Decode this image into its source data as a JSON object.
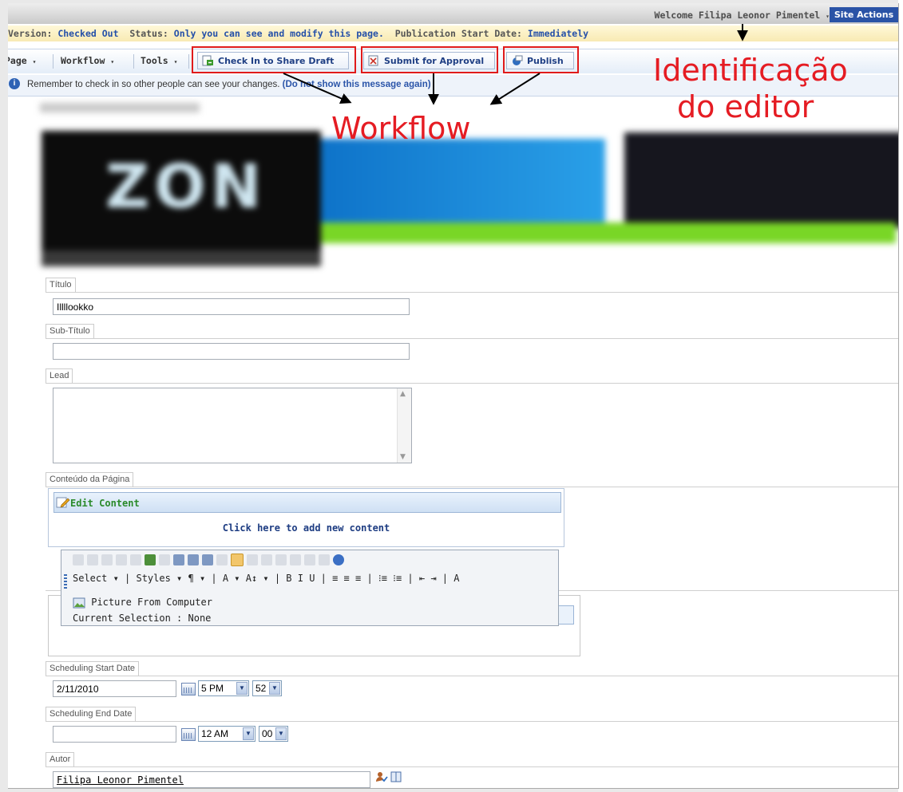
{
  "header": {
    "welcome": "Welcome Filipa Leonor Pimentel",
    "welcome_caret": "▾",
    "site_actions": "Site Actions"
  },
  "version_bar": {
    "version_label": "Version:",
    "version_value": "Checked Out",
    "status_label": "Status:",
    "status_value": "Only you can see and modify this page.",
    "pub_label": "Publication Start Date:",
    "pub_value": "Immediately"
  },
  "toolbar": {
    "page": "Page",
    "workflow": "Workflow",
    "tools": "Tools",
    "caret": "▾",
    "check_in": "Check In to Share Draft",
    "submit": "Submit for Approval",
    "publish": "Publish"
  },
  "info": {
    "message": "Remember to check in so other people can see your changes.",
    "link": "(Do not show this message again)"
  },
  "annotations": {
    "editor_line1": "Identificação",
    "editor_line2": "do editor",
    "workflow": "Workflow"
  },
  "banner": {
    "logo_text": "ZON"
  },
  "form": {
    "titulo_label": "Título",
    "titulo_value": "Illllookko",
    "subtitulo_label": "Sub-Título",
    "subtitulo_value": "",
    "lead_label": "Lead",
    "conteudo_label": "Conteúdo da Página",
    "edit_content": "Edit Content",
    "add_content": "Click here to add new content",
    "rte_row2": "Select ▾ | Styles ▾  ¶ ▾ | A ▾  A↕ ▾ |  B  I  U  | ≡ ≡ ≡ | ⁝≡ ⁝≡ | ⇤ ⇥ | A",
    "rte_picture": "Picture From Computer",
    "rte_selection": "Current Selection : None",
    "start_label": "Scheduling Start Date",
    "start_date": "2/11/2010",
    "start_hour": "5 PM",
    "start_min": "52",
    "end_label": "Scheduling End Date",
    "end_date": "",
    "end_hour": "12 AM",
    "end_min": "00",
    "autor_label": "Autor",
    "autor_value": "Filipa Leonor Pimentel"
  },
  "colors": {
    "annotation_red": "#e51c23",
    "link_blue": "#2550a8",
    "site_actions_bg": "#2a53a6"
  }
}
